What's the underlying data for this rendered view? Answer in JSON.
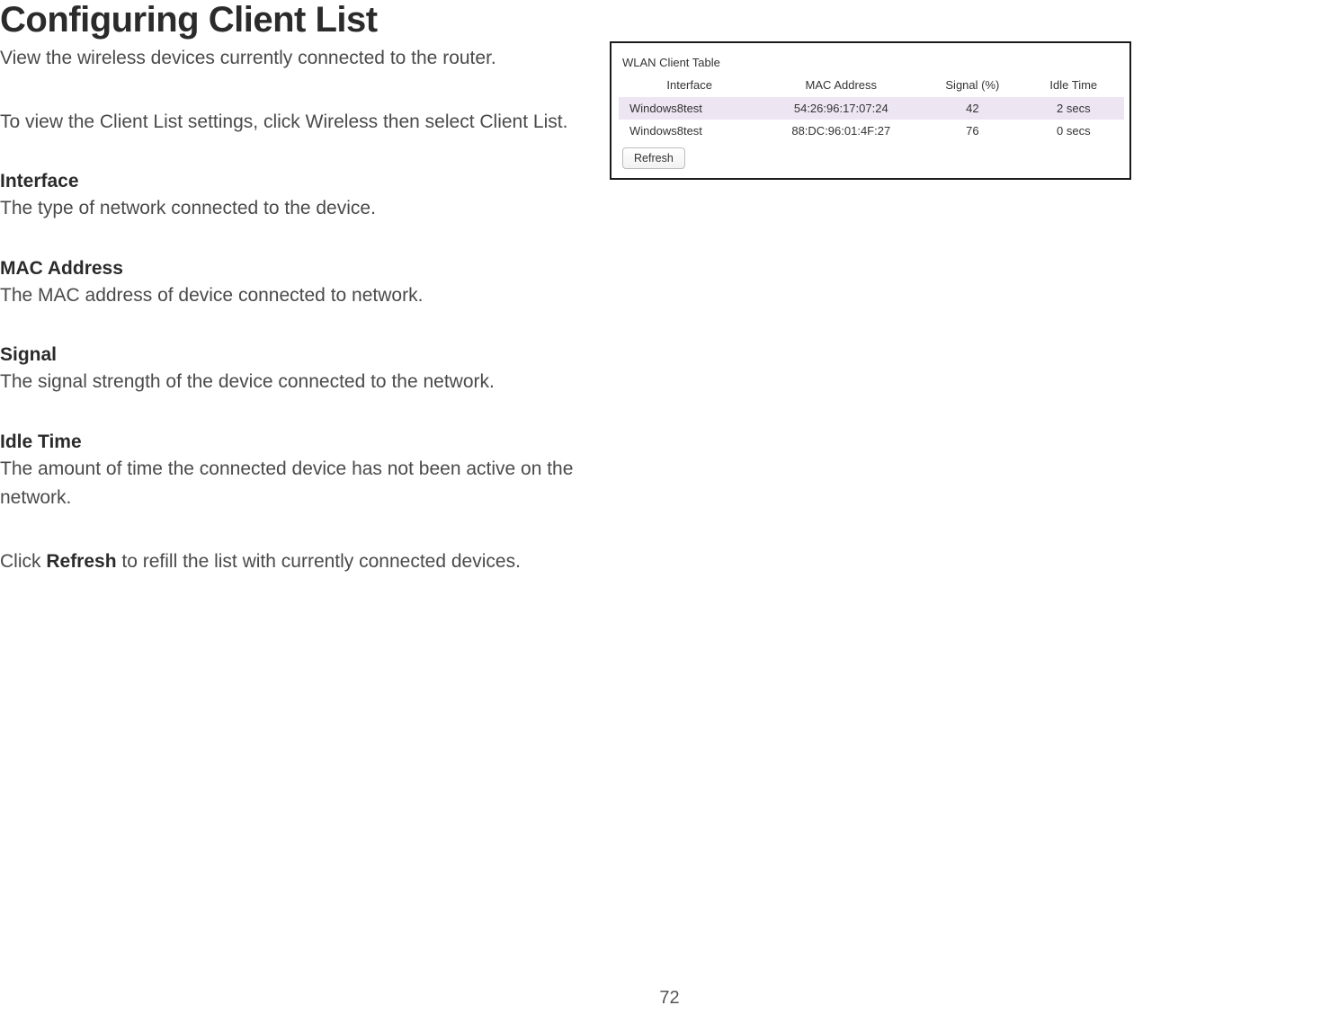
{
  "page": {
    "title": "Configuring Client List",
    "intro": "View the wireless devices currently connected to the router.",
    "instruction": "To view the Client List settings, click Wireless then select Client List.",
    "defs": [
      {
        "term": "Interface",
        "desc": "The type of network connected to the device."
      },
      {
        "term": "MAC Address",
        "desc": "The MAC address of device connected to network."
      },
      {
        "term": "Signal",
        "desc": "The signal strength of the device connected to the network."
      },
      {
        "term": "Idle Time",
        "desc": "The amount of time the connected device has not been active on the network."
      }
    ],
    "final_pre": "Click ",
    "final_bold": "Refresh",
    "final_post": " to refill the list with currently connected devices.",
    "number": "72"
  },
  "panel": {
    "caption": "WLAN Client Table",
    "headers": {
      "interface": "Interface",
      "mac": "MAC Address",
      "signal": "Signal (%)",
      "idle": "Idle Time"
    },
    "rows": [
      {
        "interface": "Windows8test",
        "mac": "54:26:96:17:07:24",
        "signal": "42",
        "idle": "2 secs"
      },
      {
        "interface": "Windows8test",
        "mac": "88:DC:96:01:4F:27",
        "signal": "76",
        "idle": "0 secs"
      }
    ],
    "refresh_label": "Refresh"
  }
}
